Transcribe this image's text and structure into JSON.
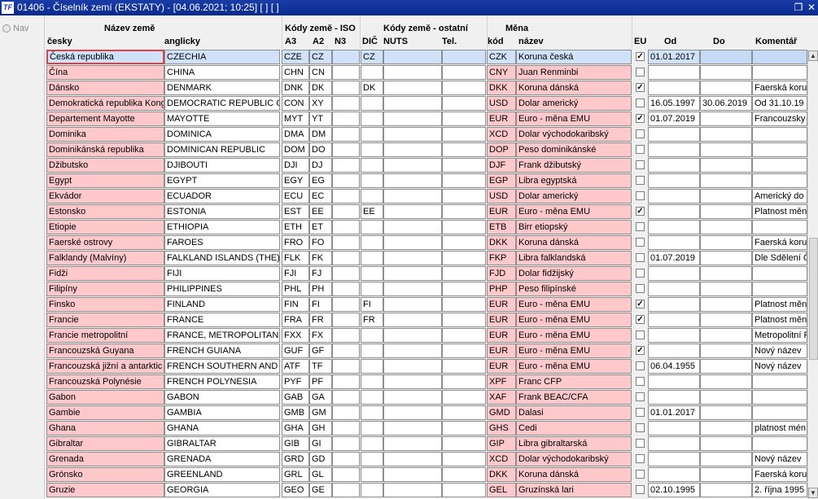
{
  "window": {
    "title": "01406 - Číselník zemí (EKSTATY) - [04.06.2021; 10:25]  [ ]  [ ]",
    "icon_text": "TF",
    "restore_glyph": "❐",
    "close_glyph": "✕"
  },
  "sidepanel": {
    "nav_label": "Nav"
  },
  "headers": {
    "nazev_zeme": "Název země",
    "cesky": "česky",
    "anglicky": "anglicky",
    "kody_iso": "Kódy země - ISO",
    "a3": "A3",
    "a2": "A2",
    "n3": "N3",
    "kody_ostatni": "Kódy země - ostatní",
    "dic": "DIČ",
    "nuts": "NUTS",
    "tel": "Tel.",
    "mena": "Měna",
    "kod": "kód",
    "nazev": "název",
    "eu": "EU",
    "od": "Od",
    "do": "Do",
    "komentar": "Komentář"
  },
  "rows": [
    {
      "cz": "Česká republika",
      "en": "CZECHIA",
      "a3": "CZE",
      "a2": "CZ",
      "n3": "",
      "dic": "CZ",
      "nuts": "",
      "tel": "",
      "kod": "CZK",
      "nazev": "Koruna česká",
      "eu": true,
      "od": "01.01.2017",
      "do": "",
      "kom": "",
      "selected": true
    },
    {
      "cz": "Čína",
      "en": "CHINA",
      "a3": "CHN",
      "a2": "CN",
      "n3": "",
      "dic": "",
      "nuts": "",
      "tel": "",
      "kod": "CNY",
      "nazev": "Juan Renminbi",
      "eu": false,
      "od": "",
      "do": "",
      "kom": ""
    },
    {
      "cz": "Dánsko",
      "en": "DENMARK",
      "a3": "DNK",
      "a2": "DK",
      "n3": "",
      "dic": "DK",
      "nuts": "",
      "tel": "",
      "kod": "DKK",
      "nazev": "Koruna dánská",
      "eu": true,
      "od": "",
      "do": "",
      "kom": "Faerská koru"
    },
    {
      "cz": "Demokratická republika Kong",
      "en": "DEMOCRATIC REPUBLIC OF T",
      "a3": "CON",
      "a2": "XY",
      "n3": "",
      "dic": "",
      "nuts": "",
      "tel": "",
      "kod": "USD",
      "nazev": "Dolar americký",
      "eu": false,
      "od": "16.05.1997",
      "do": "30.06.2019",
      "kom": "Od 31.10.19"
    },
    {
      "cz": "Departement Mayotte",
      "en": "MAYOTTE",
      "a3": "MYT",
      "a2": "YT",
      "n3": "",
      "dic": "",
      "nuts": "",
      "tel": "",
      "kod": "EUR",
      "nazev": "Euro - měna EMU",
      "eu": true,
      "od": "01.07.2019",
      "do": "",
      "kom": "Francouzsky"
    },
    {
      "cz": "Dominika",
      "en": "DOMINICA",
      "a3": "DMA",
      "a2": "DM",
      "n3": "",
      "dic": "",
      "nuts": "",
      "tel": "",
      "kod": "XCD",
      "nazev": "Dolar východokaribský",
      "eu": false,
      "od": "",
      "do": "",
      "kom": ""
    },
    {
      "cz": "Dominikánská republika",
      "en": "DOMINICAN REPUBLIC",
      "a3": "DOM",
      "a2": "DO",
      "n3": "",
      "dic": "",
      "nuts": "",
      "tel": "",
      "kod": "DOP",
      "nazev": "Peso dominikánské",
      "eu": false,
      "od": "",
      "do": "",
      "kom": ""
    },
    {
      "cz": "Džibutsko",
      "en": "DJIBOUTI",
      "a3": "DJI",
      "a2": "DJ",
      "n3": "",
      "dic": "",
      "nuts": "",
      "tel": "",
      "kod": "DJF",
      "nazev": "Frank džibutský",
      "eu": false,
      "od": "",
      "do": "",
      "kom": ""
    },
    {
      "cz": "Egypt",
      "en": "EGYPT",
      "a3": "EGY",
      "a2": "EG",
      "n3": "",
      "dic": "",
      "nuts": "",
      "tel": "",
      "kod": "EGP",
      "nazev": "Libra egyptská",
      "eu": false,
      "od": "",
      "do": "",
      "kom": ""
    },
    {
      "cz": "Ekvádor",
      "en": "ECUADOR",
      "a3": "ECU",
      "a2": "EC",
      "n3": "",
      "dic": "",
      "nuts": "",
      "tel": "",
      "kod": "USD",
      "nazev": "Dolar americký",
      "eu": false,
      "od": "",
      "do": "",
      "kom": "Americký do"
    },
    {
      "cz": "Estonsko",
      "en": "ESTONIA",
      "a3": "EST",
      "a2": "EE",
      "n3": "",
      "dic": "EE",
      "nuts": "",
      "tel": "",
      "kod": "EUR",
      "nazev": "Euro - měna EMU",
      "eu": true,
      "od": "",
      "do": "",
      "kom": "Platnost měn"
    },
    {
      "cz": "Etiopie",
      "en": "ETHIOPIA",
      "a3": "ETH",
      "a2": "ET",
      "n3": "",
      "dic": "",
      "nuts": "",
      "tel": "",
      "kod": "ETB",
      "nazev": "Birr etiopský",
      "eu": false,
      "od": "",
      "do": "",
      "kom": ""
    },
    {
      "cz": "Faerské ostrovy",
      "en": "FAROES",
      "a3": "FRO",
      "a2": "FO",
      "n3": "",
      "dic": "",
      "nuts": "",
      "tel": "",
      "kod": "DKK",
      "nazev": "Koruna dánská",
      "eu": false,
      "od": "",
      "do": "",
      "kom": "Faerská koru"
    },
    {
      "cz": "Falklandy (Malvíny)",
      "en": "FALKLAND ISLANDS (THE) (",
      "a3": "FLK",
      "a2": "FK",
      "n3": "",
      "dic": "",
      "nuts": "",
      "tel": "",
      "kod": "FKP",
      "nazev": "Libra falklandská",
      "eu": false,
      "od": "01.07.2019",
      "do": "",
      "kom": "Dle Sdělení Č"
    },
    {
      "cz": "Fidži",
      "en": "FIJI",
      "a3": "FJI",
      "a2": "FJ",
      "n3": "",
      "dic": "",
      "nuts": "",
      "tel": "",
      "kod": "FJD",
      "nazev": "Dolar fidžijský",
      "eu": false,
      "od": "",
      "do": "",
      "kom": ""
    },
    {
      "cz": "Filipíny",
      "en": "PHILIPPINES",
      "a3": "PHL",
      "a2": "PH",
      "n3": "",
      "dic": "",
      "nuts": "",
      "tel": "",
      "kod": "PHP",
      "nazev": "Peso filipínské",
      "eu": false,
      "od": "",
      "do": "",
      "kom": ""
    },
    {
      "cz": "Finsko",
      "en": "FINLAND",
      "a3": "FIN",
      "a2": "FI",
      "n3": "",
      "dic": "FI",
      "nuts": "",
      "tel": "",
      "kod": "EUR",
      "nazev": "Euro - měna EMU",
      "eu": true,
      "od": "",
      "do": "",
      "kom": "Platnost měn"
    },
    {
      "cz": "Francie",
      "en": "FRANCE",
      "a3": "FRA",
      "a2": "FR",
      "n3": "",
      "dic": "FR",
      "nuts": "",
      "tel": "",
      "kod": "EUR",
      "nazev": "Euro - měna EMU",
      "eu": true,
      "od": "",
      "do": "",
      "kom": "Platnost měn"
    },
    {
      "cz": "Francie metropolitní",
      "en": "FRANCE, METROPOLITAN",
      "a3": "FXX",
      "a2": "FX",
      "n3": "",
      "dic": "",
      "nuts": "",
      "tel": "",
      "kod": "EUR",
      "nazev": "Euro - měna EMU",
      "eu": false,
      "od": "",
      "do": "",
      "kom": "Metropolitní F"
    },
    {
      "cz": "Francouzská Guyana",
      "en": "FRENCH GUIANA",
      "a3": "GUF",
      "a2": "GF",
      "n3": "",
      "dic": "",
      "nuts": "",
      "tel": "",
      "kod": "EUR",
      "nazev": "Euro - měna EMU",
      "eu": true,
      "od": "",
      "do": "",
      "kom": "Nový název"
    },
    {
      "cz": "Francouzská jižní a antarktic",
      "en": "FRENCH SOUTHERN AND AN",
      "a3": "ATF",
      "a2": "TF",
      "n3": "",
      "dic": "",
      "nuts": "",
      "tel": "",
      "kod": "EUR",
      "nazev": "Euro - měna EMU",
      "eu": false,
      "od": "06.04.1955",
      "do": "",
      "kom": "Nový název"
    },
    {
      "cz": "Francouzská Polynésie",
      "en": "FRENCH POLYNESIA",
      "a3": "PYF",
      "a2": "PF",
      "n3": "",
      "dic": "",
      "nuts": "",
      "tel": "",
      "kod": "XPF",
      "nazev": "Franc CFP",
      "eu": false,
      "od": "",
      "do": "",
      "kom": ""
    },
    {
      "cz": "Gabon",
      "en": "GABON",
      "a3": "GAB",
      "a2": "GA",
      "n3": "",
      "dic": "",
      "nuts": "",
      "tel": "",
      "kod": "XAF",
      "nazev": "Frank BEAC/CFA",
      "eu": false,
      "od": "",
      "do": "",
      "kom": ""
    },
    {
      "cz": "Gambie",
      "en": "GAMBIA",
      "a3": "GMB",
      "a2": "GM",
      "n3": "",
      "dic": "",
      "nuts": "",
      "tel": "",
      "kod": "GMD",
      "nazev": "Dalasi",
      "eu": false,
      "od": "01.01.2017",
      "do": "",
      "kom": ""
    },
    {
      "cz": "Ghana",
      "en": "GHANA",
      "a3": "GHA",
      "a2": "GH",
      "n3": "",
      "dic": "",
      "nuts": "",
      "tel": "",
      "kod": "GHS",
      "nazev": "Cedi",
      "eu": false,
      "od": "",
      "do": "",
      "kom": "platnost mén"
    },
    {
      "cz": "Gibraltar",
      "en": "GIBRALTAR",
      "a3": "GIB",
      "a2": "GI",
      "n3": "",
      "dic": "",
      "nuts": "",
      "tel": "",
      "kod": "GIP",
      "nazev": "Libra gibraltarská",
      "eu": false,
      "od": "",
      "do": "",
      "kom": ""
    },
    {
      "cz": "Grenada",
      "en": "GRENADA",
      "a3": "GRD",
      "a2": "GD",
      "n3": "",
      "dic": "",
      "nuts": "",
      "tel": "",
      "kod": "XCD",
      "nazev": "Dolar východokaribský",
      "eu": false,
      "od": "",
      "do": "",
      "kom": "Nový název"
    },
    {
      "cz": "Grónsko",
      "en": "GREENLAND",
      "a3": "GRL",
      "a2": "GL",
      "n3": "",
      "dic": "",
      "nuts": "",
      "tel": "",
      "kod": "DKK",
      "nazev": "Koruna dánská",
      "eu": false,
      "od": "",
      "do": "",
      "kom": "Faerská koru"
    },
    {
      "cz": "Gruzie",
      "en": "GEORGIA",
      "a3": "GEO",
      "a2": "GE",
      "n3": "",
      "dic": "",
      "nuts": "",
      "tel": "",
      "kod": "GEL",
      "nazev": "Gruzínská lari",
      "eu": false,
      "od": "02.10.1995",
      "do": "",
      "kom": "2. října 1995"
    }
  ],
  "colors": {
    "pink_cell": "#ffc9cc",
    "selected_row": "#cfe2f9",
    "titlebar": "#0a2a8e",
    "focus_border": "#dd4444"
  }
}
